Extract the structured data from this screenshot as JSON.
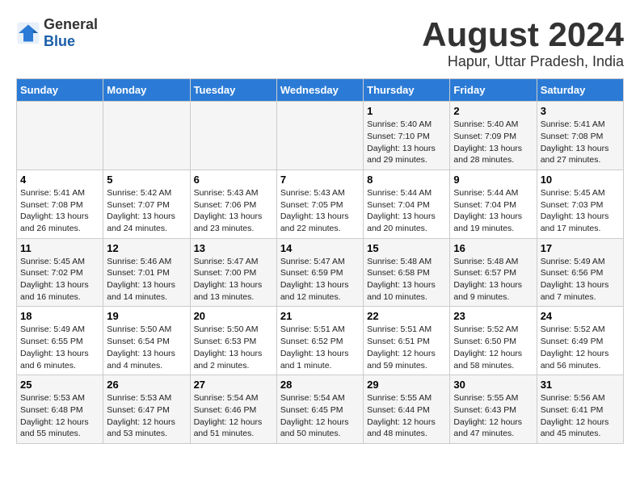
{
  "header": {
    "logo_general": "General",
    "logo_blue": "Blue",
    "month_title": "August 2024",
    "location": "Hapur, Uttar Pradesh, India"
  },
  "days_of_week": [
    "Sunday",
    "Monday",
    "Tuesday",
    "Wednesday",
    "Thursday",
    "Friday",
    "Saturday"
  ],
  "weeks": [
    [
      {
        "day": "",
        "content": ""
      },
      {
        "day": "",
        "content": ""
      },
      {
        "day": "",
        "content": ""
      },
      {
        "day": "",
        "content": ""
      },
      {
        "day": "1",
        "content": "Sunrise: 5:40 AM\nSunset: 7:10 PM\nDaylight: 13 hours\nand 29 minutes."
      },
      {
        "day": "2",
        "content": "Sunrise: 5:40 AM\nSunset: 7:09 PM\nDaylight: 13 hours\nand 28 minutes."
      },
      {
        "day": "3",
        "content": "Sunrise: 5:41 AM\nSunset: 7:08 PM\nDaylight: 13 hours\nand 27 minutes."
      }
    ],
    [
      {
        "day": "4",
        "content": "Sunrise: 5:41 AM\nSunset: 7:08 PM\nDaylight: 13 hours\nand 26 minutes."
      },
      {
        "day": "5",
        "content": "Sunrise: 5:42 AM\nSunset: 7:07 PM\nDaylight: 13 hours\nand 24 minutes."
      },
      {
        "day": "6",
        "content": "Sunrise: 5:43 AM\nSunset: 7:06 PM\nDaylight: 13 hours\nand 23 minutes."
      },
      {
        "day": "7",
        "content": "Sunrise: 5:43 AM\nSunset: 7:05 PM\nDaylight: 13 hours\nand 22 minutes."
      },
      {
        "day": "8",
        "content": "Sunrise: 5:44 AM\nSunset: 7:04 PM\nDaylight: 13 hours\nand 20 minutes."
      },
      {
        "day": "9",
        "content": "Sunrise: 5:44 AM\nSunset: 7:04 PM\nDaylight: 13 hours\nand 19 minutes."
      },
      {
        "day": "10",
        "content": "Sunrise: 5:45 AM\nSunset: 7:03 PM\nDaylight: 13 hours\nand 17 minutes."
      }
    ],
    [
      {
        "day": "11",
        "content": "Sunrise: 5:45 AM\nSunset: 7:02 PM\nDaylight: 13 hours\nand 16 minutes."
      },
      {
        "day": "12",
        "content": "Sunrise: 5:46 AM\nSunset: 7:01 PM\nDaylight: 13 hours\nand 14 minutes."
      },
      {
        "day": "13",
        "content": "Sunrise: 5:47 AM\nSunset: 7:00 PM\nDaylight: 13 hours\nand 13 minutes."
      },
      {
        "day": "14",
        "content": "Sunrise: 5:47 AM\nSunset: 6:59 PM\nDaylight: 13 hours\nand 12 minutes."
      },
      {
        "day": "15",
        "content": "Sunrise: 5:48 AM\nSunset: 6:58 PM\nDaylight: 13 hours\nand 10 minutes."
      },
      {
        "day": "16",
        "content": "Sunrise: 5:48 AM\nSunset: 6:57 PM\nDaylight: 13 hours\nand 9 minutes."
      },
      {
        "day": "17",
        "content": "Sunrise: 5:49 AM\nSunset: 6:56 PM\nDaylight: 13 hours\nand 7 minutes."
      }
    ],
    [
      {
        "day": "18",
        "content": "Sunrise: 5:49 AM\nSunset: 6:55 PM\nDaylight: 13 hours\nand 6 minutes."
      },
      {
        "day": "19",
        "content": "Sunrise: 5:50 AM\nSunset: 6:54 PM\nDaylight: 13 hours\nand 4 minutes."
      },
      {
        "day": "20",
        "content": "Sunrise: 5:50 AM\nSunset: 6:53 PM\nDaylight: 13 hours\nand 2 minutes."
      },
      {
        "day": "21",
        "content": "Sunrise: 5:51 AM\nSunset: 6:52 PM\nDaylight: 13 hours\nand 1 minute."
      },
      {
        "day": "22",
        "content": "Sunrise: 5:51 AM\nSunset: 6:51 PM\nDaylight: 12 hours\nand 59 minutes."
      },
      {
        "day": "23",
        "content": "Sunrise: 5:52 AM\nSunset: 6:50 PM\nDaylight: 12 hours\nand 58 minutes."
      },
      {
        "day": "24",
        "content": "Sunrise: 5:52 AM\nSunset: 6:49 PM\nDaylight: 12 hours\nand 56 minutes."
      }
    ],
    [
      {
        "day": "25",
        "content": "Sunrise: 5:53 AM\nSunset: 6:48 PM\nDaylight: 12 hours\nand 55 minutes."
      },
      {
        "day": "26",
        "content": "Sunrise: 5:53 AM\nSunset: 6:47 PM\nDaylight: 12 hours\nand 53 minutes."
      },
      {
        "day": "27",
        "content": "Sunrise: 5:54 AM\nSunset: 6:46 PM\nDaylight: 12 hours\nand 51 minutes."
      },
      {
        "day": "28",
        "content": "Sunrise: 5:54 AM\nSunset: 6:45 PM\nDaylight: 12 hours\nand 50 minutes."
      },
      {
        "day": "29",
        "content": "Sunrise: 5:55 AM\nSunset: 6:44 PM\nDaylight: 12 hours\nand 48 minutes."
      },
      {
        "day": "30",
        "content": "Sunrise: 5:55 AM\nSunset: 6:43 PM\nDaylight: 12 hours\nand 47 minutes."
      },
      {
        "day": "31",
        "content": "Sunrise: 5:56 AM\nSunset: 6:41 PM\nDaylight: 12 hours\nand 45 minutes."
      }
    ]
  ]
}
